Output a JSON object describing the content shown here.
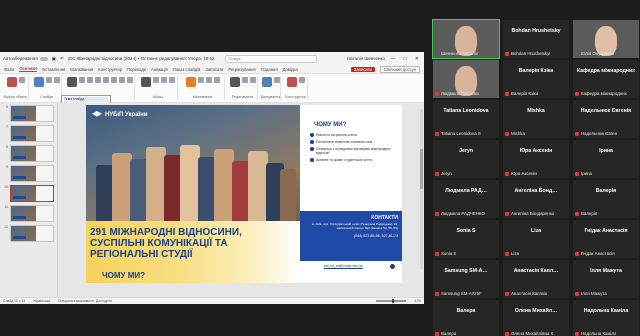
{
  "powerpoint": {
    "autosave_label": "Автозбереження",
    "doc_title": "291 Міжнародні відносини (2024) • Останнє редагування: Учора, 19:52",
    "search_placeholder": "Пошук",
    "user_name": "Наталія Шевченко",
    "window_controls": [
      "—",
      "□",
      "✕"
    ],
    "tabs": [
      "Файл",
      "Основне",
      "Вставлення",
      "Малювання",
      "Конструктор",
      "Переходи",
      "Анімація",
      "Показ слайдів",
      "Записати",
      "Рецензування",
      "Подання",
      "Довідка"
    ],
    "active_tab": "Основне",
    "record_button": "Записати",
    "share_button": "Спільний доступ",
    "ribbon_groups": [
      {
        "label": "Буфер обміну",
        "color": "#c0504d"
      },
      {
        "label": "Слайди",
        "color": "#4f81bd"
      },
      {
        "label": "Шрифт",
        "color": "#555555"
      },
      {
        "label": "Абзац",
        "color": "#555555"
      },
      {
        "label": "Малювання",
        "color": "#e67e22"
      },
      {
        "label": "Редагування",
        "color": "#555555"
      },
      {
        "label": "Диктування",
        "color": "#4f81bd"
      },
      {
        "label": "Конструктор",
        "color": "#c0504d"
      }
    ],
    "font_popup": [
      "Тема слайда",
      "Макет слайда",
      "Скинути макет"
    ],
    "thumbnails": [
      "6",
      "7",
      "8",
      "9",
      "10",
      "11",
      "12"
    ],
    "selected_thumbnail": "10",
    "notes_placeholder": "Нотатки до слайда",
    "status": {
      "slide_info": "Слайд 10 з 13",
      "language": "Українська",
      "accessibility": "Спеціальні можливості: Дослідити",
      "zoom": "47%"
    }
  },
  "slide": {
    "logo_text": "НУБіП України",
    "big_title": "291 Міжнародні відносини, суспільні комунікації та регіональні студії",
    "why_bottom": "ЧОМУ МИ?",
    "why_title": "ЧОМУ МИ?",
    "why_items": [
      "Якісна та актуальна освіта",
      "Поглиблене вивчення іноземних мов",
      "Співпраця з провідними фахівцями міжнародних відносин",
      "Активне та цікаве студентське життя"
    ],
    "contacts_title": "КОНТАКТИ",
    "contacts_address": "м. Київ, вул. Горіхуватський шлях (Генерала Родімцева), 19, навчальний корпус №1 (кімната 54, 55, 56)",
    "contacts_phone": "(044) 527-85-56, 527-81-73",
    "contacts_email": "kaf_int_ed@nubip.edu.ua"
  },
  "participants": [
    {
      "id": "p1",
      "label": "Шевченко Наталія",
      "video": true,
      "active": true,
      "mic_off": false
    },
    {
      "id": "p2",
      "label": "Bohdan Hrushetsky",
      "sub": "Bohdan Hrushetskyi",
      "video": false,
      "mic_off": true
    },
    {
      "id": "p3",
      "label": "Юлія Онуфрієва",
      "video": true,
      "mic_off": false
    },
    {
      "id": "p4",
      "label": "Людмила Панасюк",
      "video": true,
      "mic_off": true
    },
    {
      "id": "p5",
      "label": "Валерія Кзіка",
      "sub": "Валерія Кзіка",
      "video": false,
      "mic_off": true
    },
    {
      "id": "p6",
      "label": "Кафедра міжнародних",
      "sub": "Кафедра міжнародних",
      "video": false,
      "mic_off": true
    },
    {
      "id": "p7",
      "label": "Tatiana Leonidova",
      "sub": "Tatiana Leonidova S",
      "video": false,
      "mic_off": true
    },
    {
      "id": "p8",
      "label": "Mishka",
      "sub": "Mishka",
      "video": false,
      "mic_off": true
    },
    {
      "id": "p9",
      "label": "Надельнюк Євгенія",
      "sub": "Надельнюк Євген",
      "video": false,
      "mic_off": true
    },
    {
      "id": "p10",
      "label": "Jeryn",
      "sub": "Jeryn",
      "video": false,
      "mic_off": true
    },
    {
      "id": "p11",
      "label": "Юра Аксенін",
      "sub": "Юра Аксенін",
      "video": false,
      "mic_off": true
    },
    {
      "id": "p12",
      "label": "Ірина",
      "sub": "Ірина",
      "video": false,
      "mic_off": true
    },
    {
      "id": "p13",
      "label": "Людмила РАД…",
      "sub": "Людмила РАДЧЕНКО",
      "video": false,
      "mic_off": true
    },
    {
      "id": "p14",
      "label": "Ангеліна Бонд…",
      "sub": "Ангеліна Бондаренко",
      "video": false,
      "mic_off": true
    },
    {
      "id": "p15",
      "label": "Валерія",
      "sub": "Валерія",
      "video": false,
      "mic_off": true
    },
    {
      "id": "p16",
      "label": "Sonia S",
      "sub": "Sonia S",
      "video": false,
      "mic_off": true
    },
    {
      "id": "p17",
      "label": "Liza",
      "sub": "Liza",
      "video": false,
      "mic_off": true
    },
    {
      "id": "p18",
      "label": "Гнідак Анастасія",
      "sub": "Гнідак Анастасія",
      "video": false,
      "mic_off": true
    },
    {
      "id": "p19",
      "label": "Samsung SM-A…",
      "sub": "Samsung SM-A725F",
      "video": false,
      "mic_off": true
    },
    {
      "id": "p20",
      "label": "Анастасія Капл…",
      "sub": "Анастасія Каплюк",
      "video": false,
      "mic_off": true
    },
    {
      "id": "p21",
      "label": "Ілля Мажута",
      "sub": "Ілля Мажута",
      "video": false,
      "mic_off": true
    },
    {
      "id": "p22",
      "label": "Валера",
      "sub": "Валера",
      "video": false,
      "mic_off": true
    },
    {
      "id": "p23",
      "label": "Олена Михайл…",
      "sub": "Олена Михайлівна К",
      "video": false,
      "mic_off": true
    },
    {
      "id": "p24",
      "label": "Надольна Каміла",
      "sub": "Надольна Каміла",
      "video": false,
      "mic_off": true
    }
  ],
  "colors": {
    "ppt_accent": "#b7472a",
    "slide_blue": "#1d3f86",
    "contacts_bg": "#1f4aa8",
    "band_yellow": "#f6d257",
    "active_speaker": "#3ccf4e",
    "mic_off": "#d83b3b"
  }
}
